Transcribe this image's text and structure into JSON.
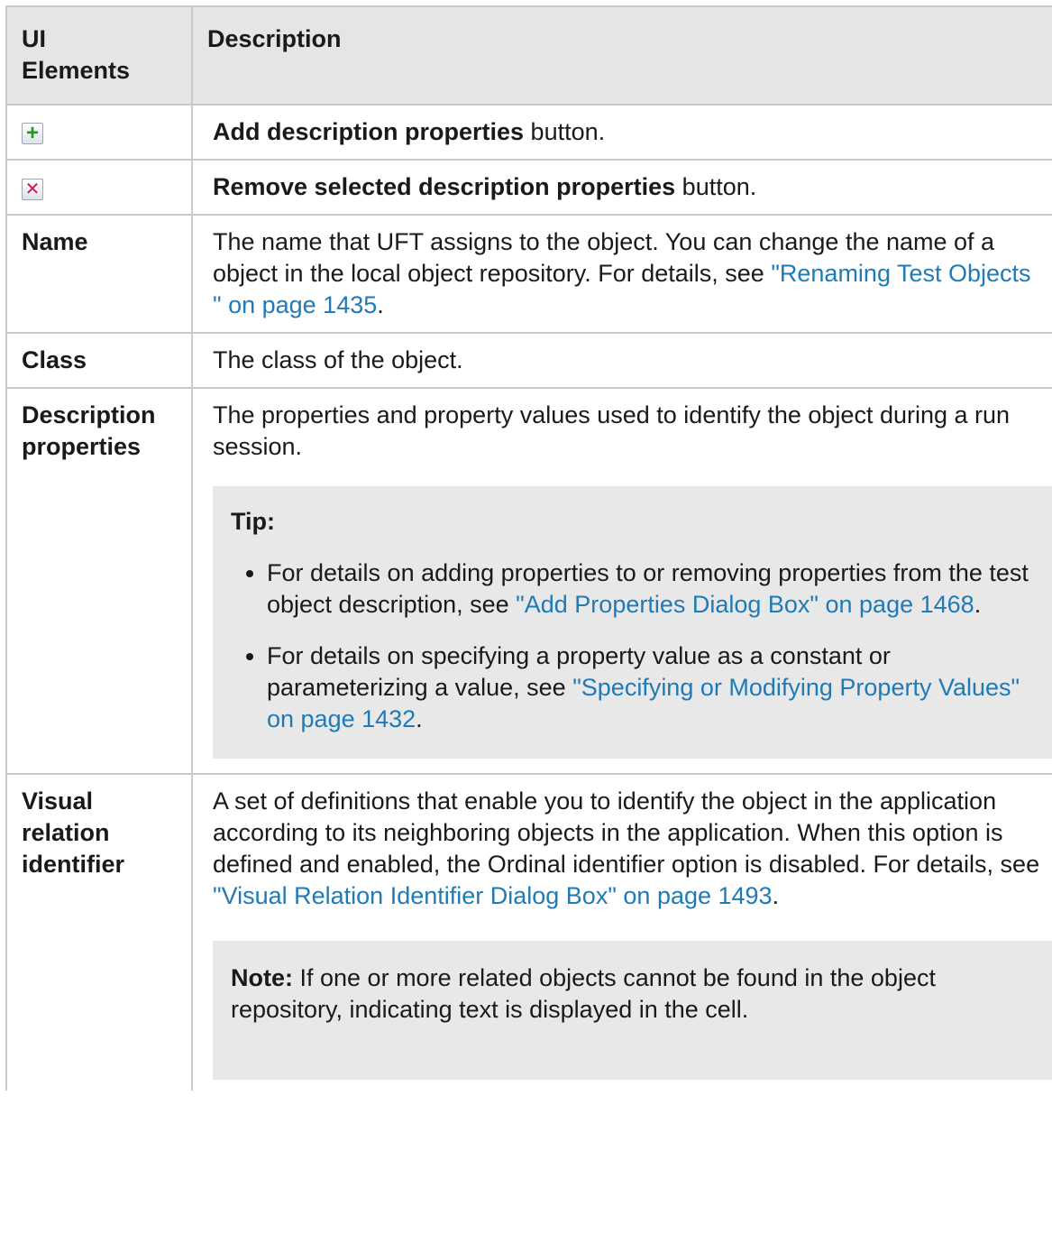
{
  "table": {
    "headers": [
      "UI Elements",
      "Description"
    ],
    "header_ui_line1": "UI",
    "header_ui_line2": "Elements",
    "header_desc": "Description"
  },
  "rows": {
    "add": {
      "icon": "add-icon",
      "glyph": "+",
      "bold": "Add description properties",
      "rest": " button."
    },
    "remove": {
      "icon": "remove-icon",
      "glyph": "✕",
      "bold": "Remove selected description properties",
      "rest": " button."
    },
    "name": {
      "label": "Name",
      "text": "The name that UFT assigns to the object. You can change the name of a object in the local object repository. For details, see ",
      "link": "\"Renaming Test Objects \" on page 1435",
      "after": "."
    },
    "class": {
      "label": "Class",
      "text": "The class of the object."
    },
    "description_properties": {
      "label_line1": "Description",
      "label_line2": "properties",
      "text": "The properties and property values used to identify the object during a run session.",
      "tip_title": "Tip:",
      "tip1_text": "For details on adding properties to or removing properties from the test object description, see ",
      "tip1_link": "\"Add Properties Dialog Box\" on page 1468",
      "tip1_after": ".",
      "tip2_text": "For details on specifying a property value as a constant or parameterizing a value, see ",
      "tip2_link": "\"Specifying or Modifying Property Values\" on page 1432",
      "tip2_after": "."
    },
    "visual_relation": {
      "label_line1": "Visual",
      "label_line2": "relation",
      "label_line3": "identifier",
      "text": "A set of definitions that enable you to identify the object in the application according to its neighboring objects in the application. When this option is defined and enabled, the Ordinal identifier option is disabled. For details, see ",
      "link": "\"Visual Relation Identifier Dialog Box\" on page 1493",
      "after": ".",
      "note_title": "Note:",
      "note_text": " If one or more related objects cannot be found in the object repository, indicating text is displayed in the cell."
    }
  },
  "colors": {
    "header_bg": "#e5e5e5",
    "border": "#c9c9c9",
    "link": "#1f7ab8",
    "callout_bg": "#e8e8e8"
  }
}
